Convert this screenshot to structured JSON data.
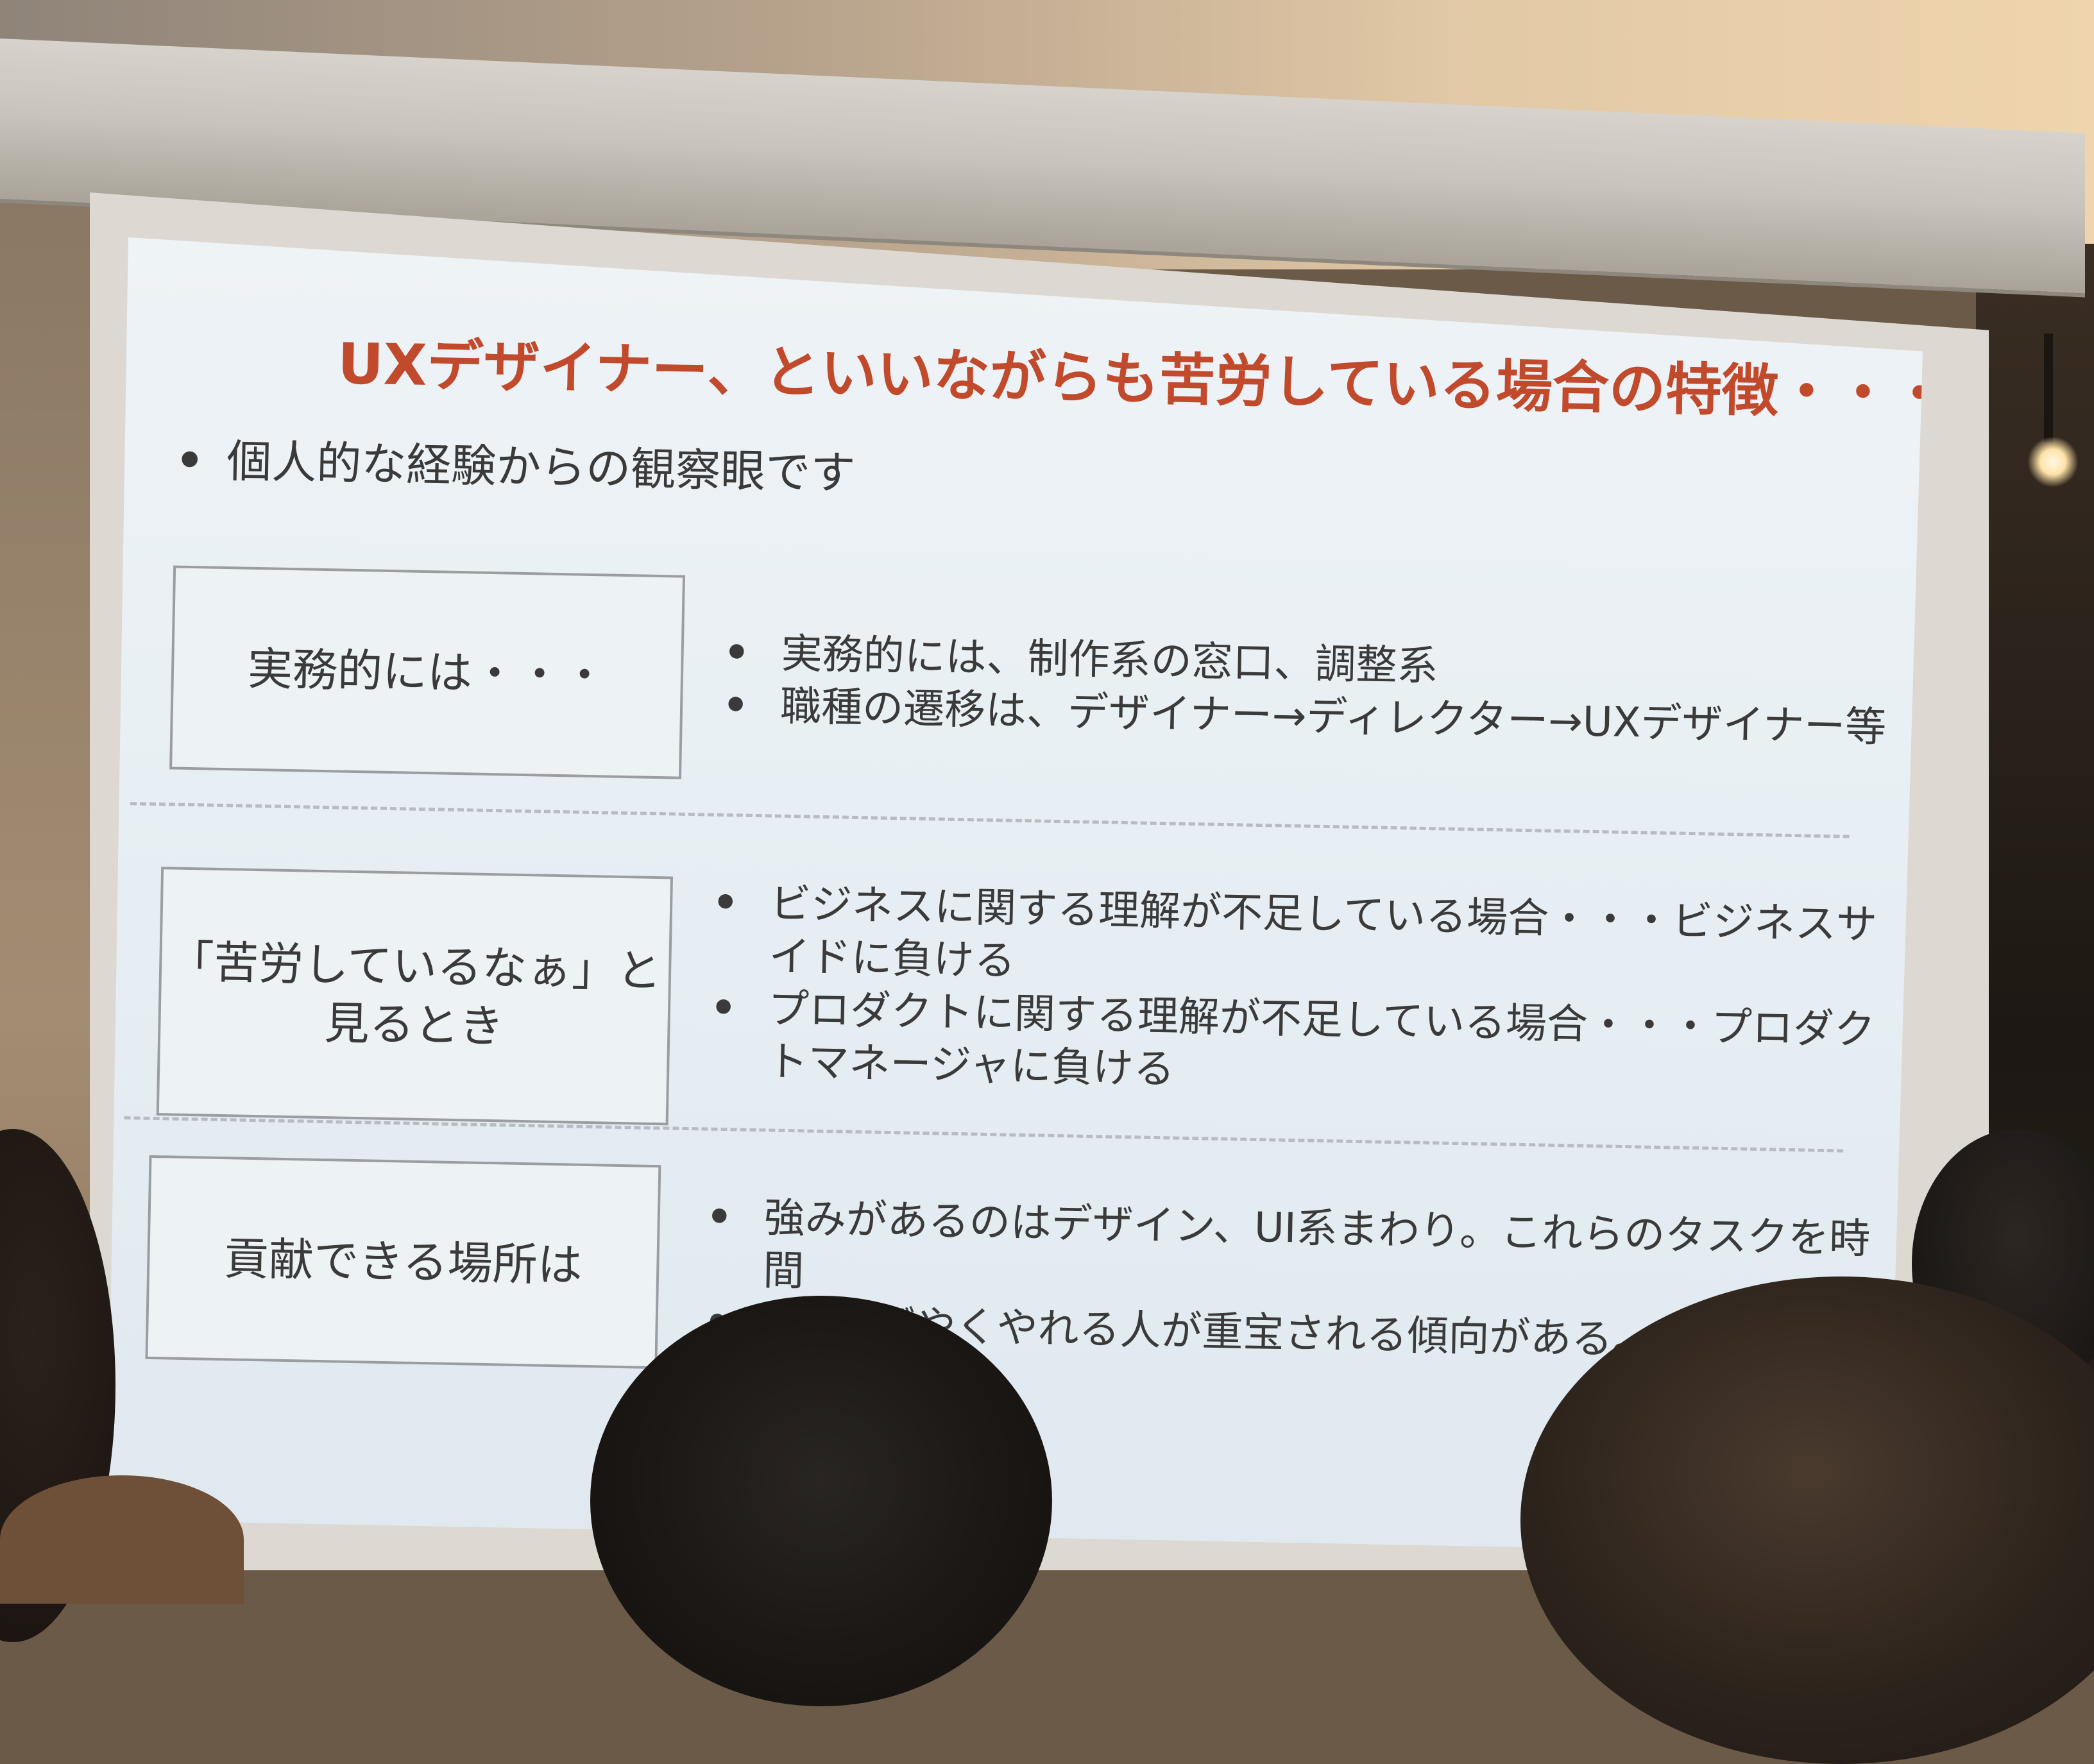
{
  "slide": {
    "title": "UXデザイナー、といいながらも苦労している場合の特徴・・・",
    "intro_bullet": "個人的な経験からの観察眼です",
    "sections": [
      {
        "label": "実務的には・・・",
        "bullets": [
          "実務的には、制作系の窓口、調整系",
          "職種の遷移は、デザイナー→ディレクター→UXデザイナー等"
        ]
      },
      {
        "label": "「苦労しているなぁ」と見るとき",
        "bullets": [
          "ビジネスに関する理解が不足している場合・・・ビジネスサイドに負ける",
          "プロダクトに関する理解が不足している場合・・・プロダクトマネージャに負ける"
        ]
      },
      {
        "label": "貢献できる場所は",
        "bullets": [
          "強みがあるのはデザイン、UI系まわり。これらのタスクを時間",
          "すばやくやれる人が重宝される傾向がある。"
        ]
      }
    ],
    "colors": {
      "title": "#c24a2c",
      "body_text": "#3a3a3a",
      "slide_background": "#e6eef3"
    }
  }
}
